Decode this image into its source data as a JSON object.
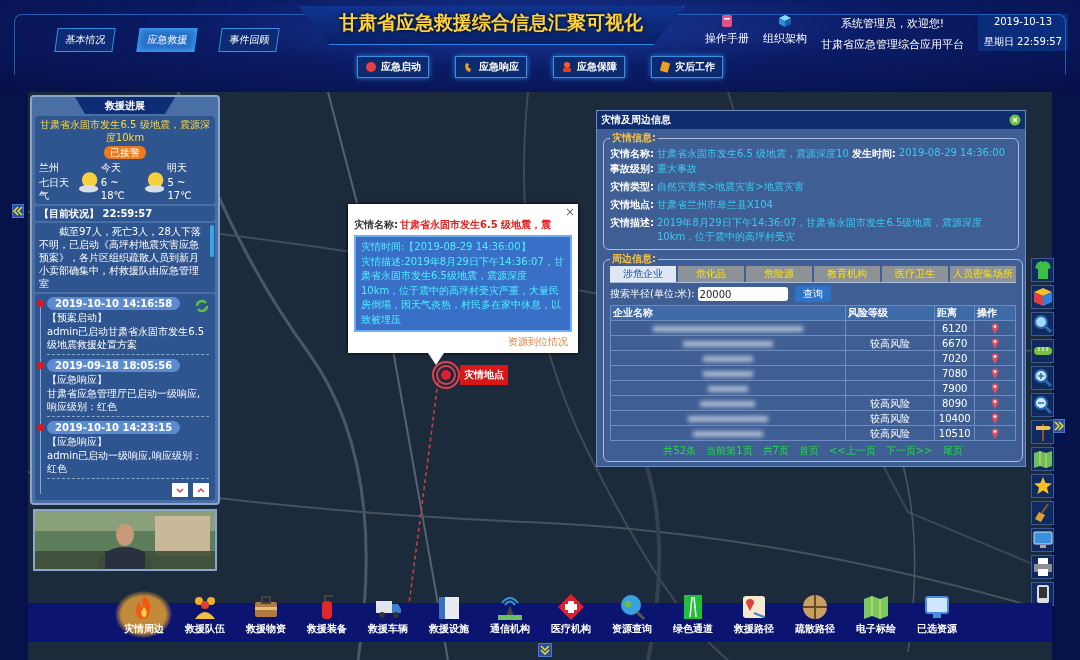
{
  "header": {
    "title": "甘肃省应急救援综合信息汇聚可视化",
    "nav_tabs": [
      {
        "label": "基本情况",
        "selected": false
      },
      {
        "label": "应急救援",
        "selected": true
      },
      {
        "label": "事件回顾",
        "selected": false
      }
    ],
    "shortcuts": [
      "操作手册",
      "组织架构"
    ],
    "greeting": "系统管理员，欢迎您!",
    "platform": "甘肃省应急管理综合应用平台",
    "date": "2019-10-13",
    "weekday_time": "星期日 22:59:57"
  },
  "stage_buttons": [
    "应急启动",
    "应急响应",
    "应急保障",
    "灾后工作"
  ],
  "progress_panel": {
    "title": "救援进展",
    "event": "甘肃省永固市发生6.5 级地震，震源深度10km",
    "status": "已接警",
    "weather": {
      "city": "兰州",
      "label": "七日天气",
      "days": [
        {
          "day": "今天",
          "range": "6 ~ 18℃"
        },
        {
          "day": "明天",
          "range": "5 ~ 17℃"
        }
      ]
    },
    "situation_label": "【目前状况】 22:59:57",
    "situation_text": "截至97人，死亡3人，28人下落不明，已启动《高坪村地震灾害应急预案》，各片区组织疏散人员到新月小卖部确集中，村救援队由应急管理室",
    "timeline": [
      {
        "time": "2019-10-10 14:16:58",
        "type": "【预案启动】",
        "text": "admin已启动甘肃省永固市发生6.5 级地震救援处置方案"
      },
      {
        "time": "2019-09-18 18:05:56",
        "type": "【应急响应】",
        "text": "甘肃省应急管理厅已启动一级响应,响应级别：红色"
      },
      {
        "time": "2019-10-10 14:23:15",
        "type": "【应急响应】",
        "text": "admin已启动一级响应,响应级别：红色"
      }
    ]
  },
  "popup": {
    "name_label": "灾情名称:",
    "name_value": "甘肃省永固市发生6.5 级地震，震",
    "close": "×",
    "time_line": "灾情时间:【2019-08-29 14:36:00】",
    "description": "灾情描述:2019年8月29日下午14:36:07，甘肃省永固市发生6.5级地震，震源深度10km，位于震中的高坪村受灾严重，大量民房倒塌，因天气炎热，村民多在家中休息，以致被埋压",
    "link": "资源到位情况"
  },
  "marker": {
    "label": "灾情地点"
  },
  "info_panel": {
    "title": "灾情及周边信息",
    "section_1": "灾情信息:",
    "fields": [
      {
        "label": "灾情名称:",
        "value": "甘肃省永固市发生6.5 级地震，震源深度10"
      },
      {
        "label": "发生时间:",
        "value": "2019-08-29 14:36:00"
      },
      {
        "label": "事故级别:",
        "value": "重大事故"
      },
      {
        "label": "灾情类型:",
        "value": "自然灾害类>地震灾害>地震灾害"
      },
      {
        "label": "灾情地点:",
        "value": "甘肃省兰州市皋兰县X104"
      },
      {
        "label": "灾情描述:",
        "value": "2019年8月29日下午14:36:07，甘肃省永固市发生6.5级地震，震源深度10km，位于震中的高坪村受灾"
      }
    ],
    "section_2": "周边信息:",
    "tabs": [
      {
        "label": "涉危企业",
        "selected": true
      },
      {
        "label": "危化品",
        "selected": false
      },
      {
        "label": "危险源",
        "selected": false
      },
      {
        "label": "教育机构",
        "selected": false
      },
      {
        "label": "医疗卫生",
        "selected": false
      },
      {
        "label": "人员密集场所",
        "selected": false
      }
    ],
    "search_label": "搜索半径(单位:米):",
    "search_value": "20000",
    "search_button": "查询",
    "columns": [
      "企业名称",
      "风险等级",
      "距离",
      "操作"
    ],
    "rows": [
      {
        "distance": "6120"
      },
      {
        "risk": "较高风险",
        "distance": "6670"
      },
      {
        "distance": "7020"
      },
      {
        "distance": "7080"
      },
      {
        "distance": "7900"
      },
      {
        "risk": "较高风险",
        "distance": "8090"
      },
      {
        "risk": "较高风险",
        "distance": "10400"
      },
      {
        "risk": "较高风险",
        "distance": "10510"
      }
    ],
    "pager": [
      "共52条",
      "当前第1页",
      "共7页",
      "首页",
      "<<上一页",
      "下一页>>",
      "尾页"
    ]
  },
  "dock": [
    {
      "label": "灾情周边",
      "selected": true
    },
    {
      "label": "救援队伍",
      "selected": false
    },
    {
      "label": "救援物资",
      "selected": false
    },
    {
      "label": "救援装备",
      "selected": false
    },
    {
      "label": "救援车辆",
      "selected": false
    },
    {
      "label": "救援设施",
      "selected": false
    },
    {
      "label": "通信机构",
      "selected": false
    },
    {
      "label": "医疗机构",
      "selected": false
    },
    {
      "label": "资源查询",
      "selected": false
    },
    {
      "label": "绿色通道",
      "selected": false
    },
    {
      "label": "救援路径",
      "selected": false
    },
    {
      "label": "疏散路径",
      "selected": false
    },
    {
      "label": "电子标绘",
      "selected": false
    },
    {
      "label": "已选资源",
      "selected": false
    }
  ]
}
